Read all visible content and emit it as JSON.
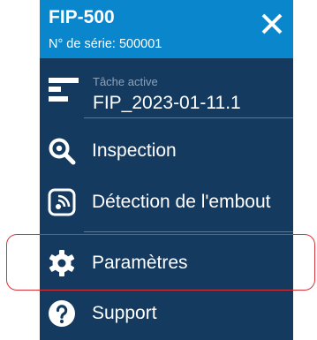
{
  "header": {
    "device_name": "FIP-500",
    "serial": "N° de série: 500001",
    "close_icon": "close-icon"
  },
  "active_task": {
    "label": "Tâche active",
    "value": "FIP_2023-01-11.1",
    "icon": "task-list-icon"
  },
  "menu": {
    "items": [
      {
        "label": "Inspection",
        "icon": "inspection-search-icon"
      },
      {
        "label": "Détection de l'embout",
        "icon": "tip-detection-icon"
      },
      {
        "label": "Paramètres",
        "icon": "gear-icon",
        "highlighted": true
      },
      {
        "label": "Support",
        "icon": "help-icon"
      }
    ]
  },
  "colors": {
    "header_bg": "#0a86cc",
    "panel_bg": "#143a60",
    "text": "#ffffff",
    "muted_text": "#8ea3ba",
    "divider": "#5a7897",
    "highlight_outline": "#d9333a"
  }
}
